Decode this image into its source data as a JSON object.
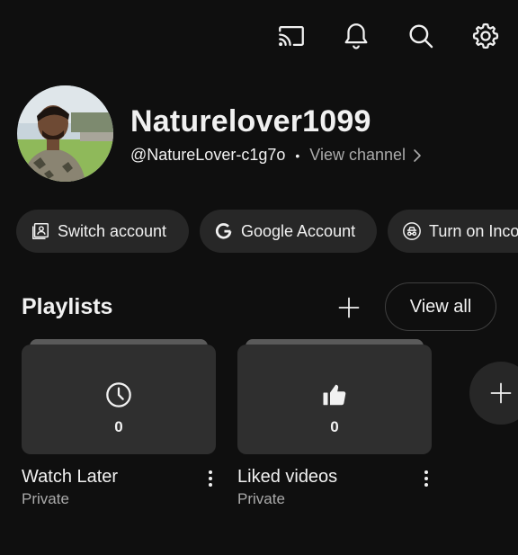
{
  "topbar": {
    "icons": [
      "cast-icon",
      "notifications-icon",
      "search-icon",
      "settings-icon"
    ]
  },
  "profile": {
    "channel_name": "Naturelover1099",
    "handle": "@NatureLover-c1g7o",
    "separator": "•",
    "view_channel": "View channel"
  },
  "chips": [
    {
      "label": "Switch account",
      "icon": "switch-account-icon"
    },
    {
      "label": "Google Account",
      "icon": "google-g-icon"
    },
    {
      "label": "Turn on Incognito",
      "icon": "incognito-icon"
    }
  ],
  "playlists": {
    "title": "Playlists",
    "view_all": "View all",
    "items": [
      {
        "title": "Watch Later",
        "privacy": "Private",
        "count": "0",
        "icon": "clock-icon"
      },
      {
        "title": "Liked videos",
        "privacy": "Private",
        "count": "0",
        "icon": "thumbs-up-icon"
      }
    ]
  },
  "colors": {
    "background": "#0f0f0f",
    "chip_bg": "#272727",
    "text_primary": "#f1f1f1",
    "text_secondary": "#aaaaaa"
  }
}
